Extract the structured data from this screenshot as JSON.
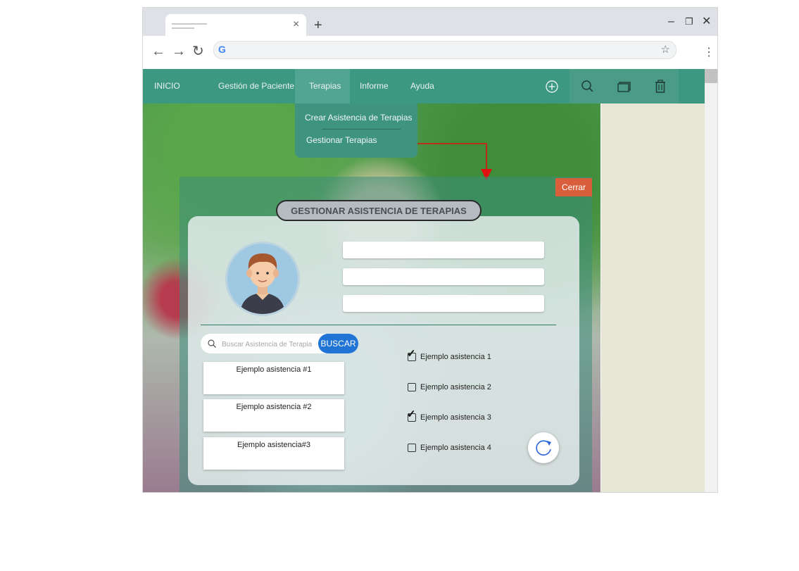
{
  "browser": {
    "new_tab": "+",
    "minimize": "–",
    "restore": "❐",
    "close": "✕",
    "back": "←",
    "forward": "→",
    "reload": "↻",
    "google_g": "G",
    "bookmark": "☆",
    "menu": "⋮",
    "tab_close": "×"
  },
  "nav": {
    "items": [
      {
        "label": "INICIO"
      },
      {
        "label": "Gestión de Paciente"
      },
      {
        "label": "Terapias"
      },
      {
        "label": "Informe"
      },
      {
        "label": "Ayuda"
      }
    ],
    "icons": [
      "add-icon",
      "search-icon",
      "window-icon",
      "trash-icon"
    ]
  },
  "dropdown": {
    "items": [
      {
        "label": "Crear Asistencia de Terapias"
      },
      {
        "label": "Gestionar Terapias"
      }
    ]
  },
  "modal": {
    "close_label": "Cerrar",
    "title": "GESTIONAR ASISTENCIA DE TERAPIAS",
    "search": {
      "placeholder": "Buscar Asistencia de Terapia",
      "button": "BUSCAR"
    },
    "results": [
      {
        "label": "Ejemplo asistencia #1"
      },
      {
        "label": "Ejemplo asistencia #2"
      },
      {
        "label": "Ejemplo asistencia#3"
      }
    ],
    "checkboxes": [
      {
        "label": "Ejemplo asistencia 1",
        "checked": true
      },
      {
        "label": "Ejemplo asistencia 2",
        "checked": false
      },
      {
        "label": "Ejemplo asistencia 3",
        "checked": true
      },
      {
        "label": "Ejemplo asistencia 4",
        "checked": false
      }
    ]
  },
  "colors": {
    "nav_bg": "#3d9882",
    "close_btn": "#d95e3b",
    "search_btn": "#1f74d6",
    "annotation_arrow": "#e01010"
  }
}
